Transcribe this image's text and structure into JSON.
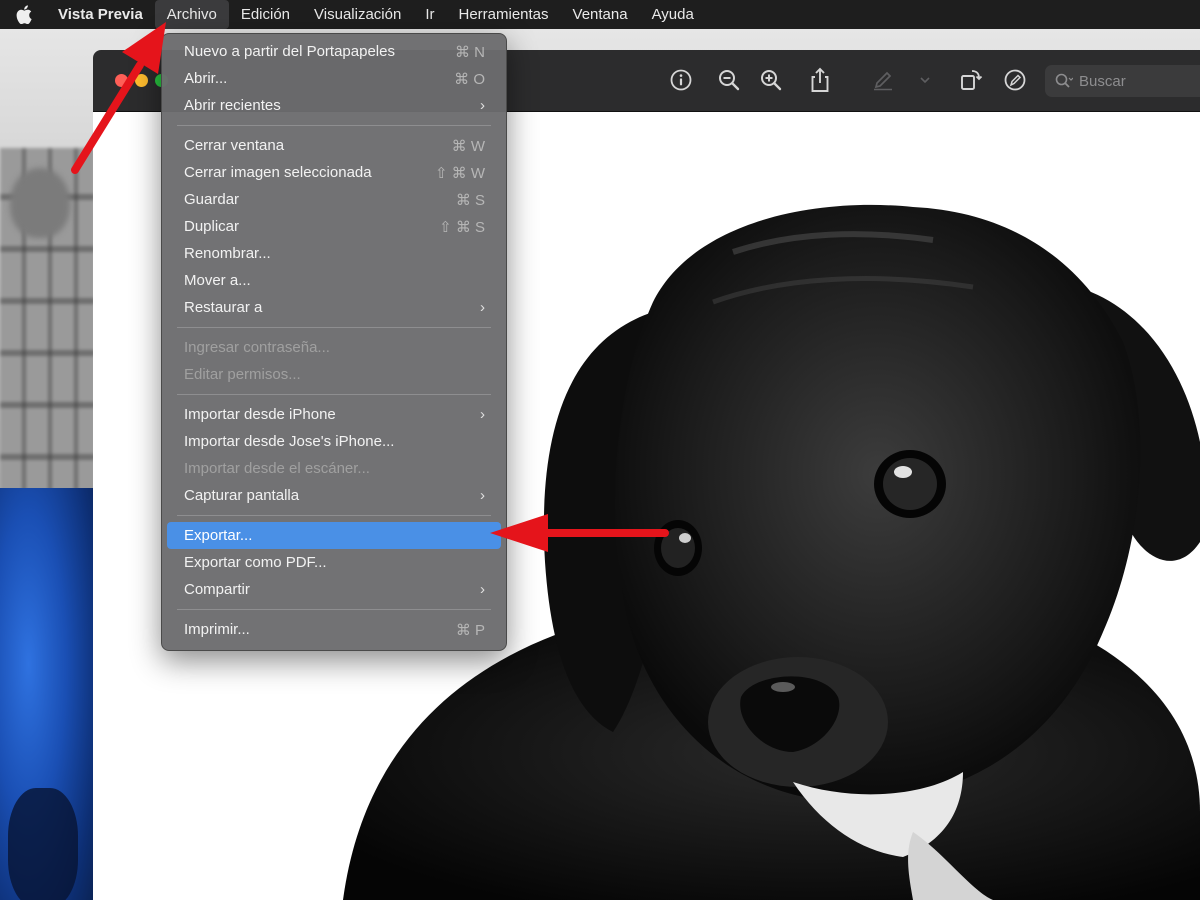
{
  "menubar": {
    "apple_icon": "apple-logo-icon",
    "app_name": "Vista Previa",
    "items": [
      "Archivo",
      "Edición",
      "Visualización",
      "Ir",
      "Herramientas",
      "Ventana",
      "Ayuda"
    ],
    "active_index": 0
  },
  "toolbar": {
    "icons": [
      "info-icon",
      "zoom-out-icon",
      "zoom-in-icon",
      "share-icon",
      "markup-pen-icon",
      "chevron-down-icon",
      "rotate-icon",
      "annotate-icon"
    ],
    "search_placeholder": "Buscar"
  },
  "archivo_menu": {
    "groups": [
      [
        {
          "label": "Nuevo a partir del Portapapeles",
          "shortcut": "⌘ N"
        },
        {
          "label": "Abrir...",
          "shortcut": "⌘ O"
        },
        {
          "label": "Abrir recientes",
          "submenu": "›"
        }
      ],
      [
        {
          "label": "Cerrar ventana",
          "shortcut": "⌘ W"
        },
        {
          "label": "Cerrar imagen seleccionada",
          "shortcut": "⇧ ⌘ W"
        },
        {
          "label": "Guardar",
          "shortcut": "⌘ S"
        },
        {
          "label": "Duplicar",
          "shortcut": "⇧ ⌘ S"
        },
        {
          "label": "Renombrar..."
        },
        {
          "label": "Mover a..."
        },
        {
          "label": "Restaurar a",
          "submenu": "›"
        }
      ],
      [
        {
          "label": "Ingresar contraseña...",
          "disabled": true
        },
        {
          "label": "Editar permisos...",
          "disabled": true
        }
      ],
      [
        {
          "label": "Importar desde iPhone",
          "submenu": "›"
        },
        {
          "label": "Importar desde Jose's iPhone..."
        },
        {
          "label": "Importar desde el escáner...",
          "disabled": true
        },
        {
          "label": "Capturar pantalla",
          "submenu": "›"
        }
      ],
      [
        {
          "label": "Exportar...",
          "highlighted": true
        },
        {
          "label": "Exportar como PDF..."
        },
        {
          "label": "Compartir",
          "submenu": "›"
        }
      ],
      [
        {
          "label": "Imprimir...",
          "shortcut": "⌘ P"
        }
      ]
    ]
  },
  "image": {
    "subject": "puppy-photo"
  },
  "colors": {
    "menubar_bg": "#1e1e1e",
    "menu_bg": "#6c6c6e",
    "highlight": "#4a90e6",
    "annotation_arrow": "#e5141b"
  }
}
